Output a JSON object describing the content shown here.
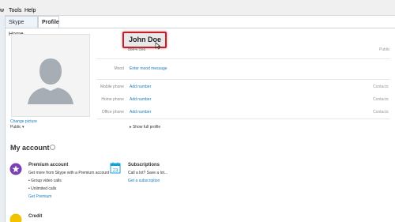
{
  "menu": {
    "partial": "w",
    "tools": "Tools",
    "help": "Help"
  },
  "tabs": [
    {
      "label": "Skype Home"
    },
    {
      "label": "Profile"
    }
  ],
  "profile": {
    "name": "John Doe",
    "username": "doe47566",
    "visibility_public": "Public",
    "change_picture": "Change picture",
    "picture_visibility": "Public ▾",
    "mood_label": "Mood",
    "mood_value": "Enter mood message",
    "mobile_label": "Mobile phone",
    "home_label": "Home phone",
    "office_label": "Office phone",
    "add_number": "Add number",
    "contacts": "Contacts",
    "show_full": "Show full profile"
  },
  "account": {
    "title": "My account",
    "premium": {
      "title": "Premium account",
      "desc": "Get more from Skype with a Premium account",
      "bullets": [
        "• Group video calls",
        "• Unlimited calls"
      ],
      "link": "Get Premium"
    },
    "subscriptions": {
      "title": "Subscriptions",
      "desc": "Call a lot? Save a lot...",
      "link": "Get a subscription"
    },
    "credit": {
      "title": "Credit"
    }
  },
  "colors": {
    "accent": "#1a7bbf",
    "highlight": "#c0202a",
    "premium": "#7b3fb4"
  }
}
